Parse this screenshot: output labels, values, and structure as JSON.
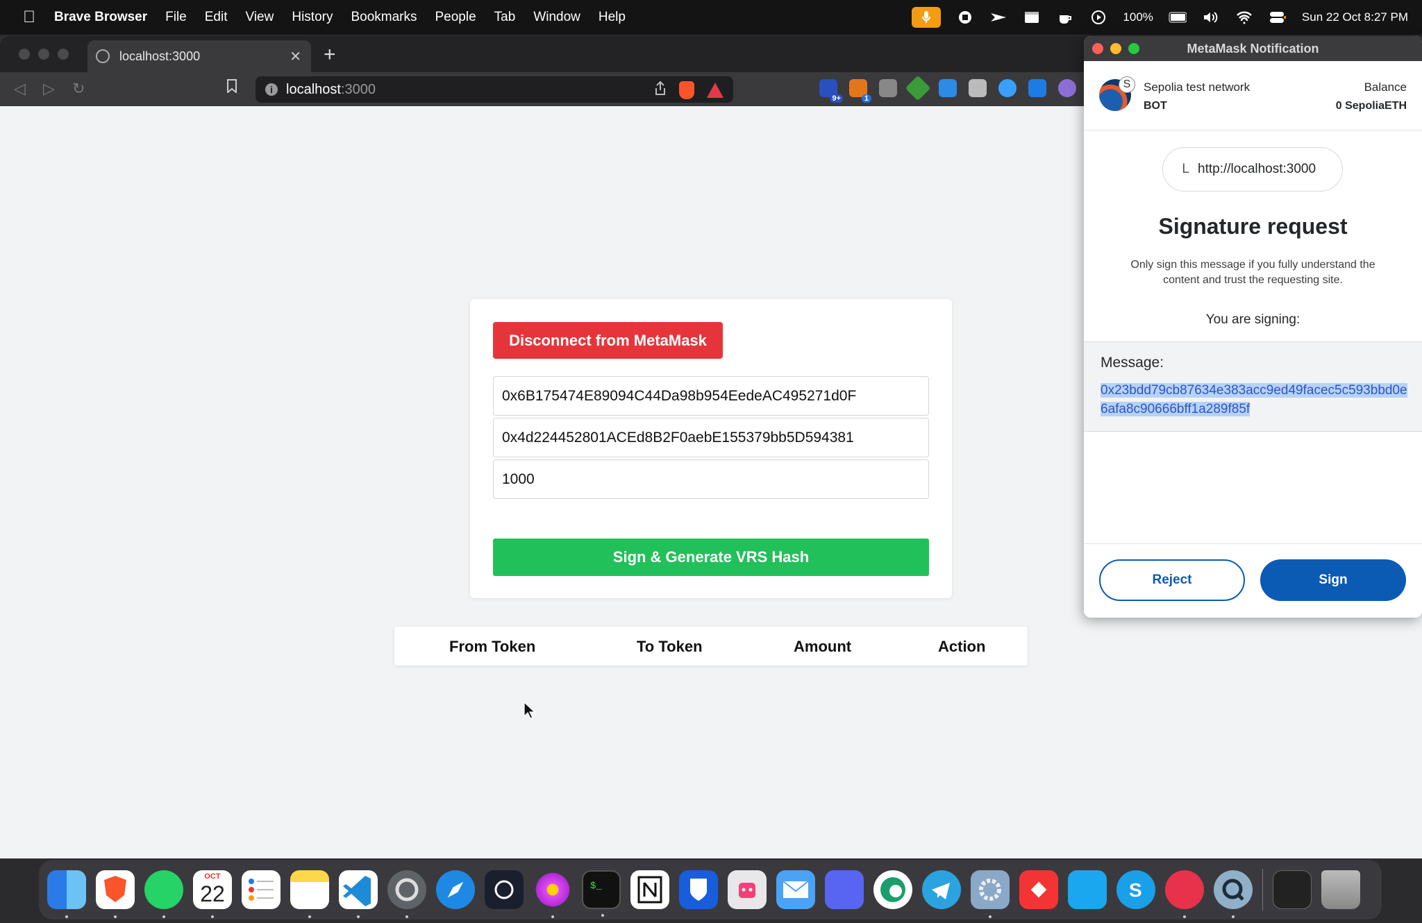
{
  "menubar": {
    "app_name": "Brave Browser",
    "items": [
      "File",
      "Edit",
      "View",
      "History",
      "Bookmarks",
      "People",
      "Tab",
      "Window",
      "Help"
    ],
    "battery": "100%",
    "datetime": "Sun 22 Oct  8:27 PM"
  },
  "browser": {
    "tab_title": "localhost:3000",
    "url_host": "localhost",
    "url_port": ":3000",
    "extension_badges": [
      "9+",
      "1"
    ]
  },
  "dapp": {
    "disconnect_label": "Disconnect from MetaMask",
    "from_token_value": "0x6B175474E89094C44Da98b954EedeAC495271d0F",
    "to_token_value": "0x4d224452801ACEd8B2F0aebE155379bb5D594381",
    "amount_value": "1000",
    "sign_label": "Sign & Generate VRS Hash",
    "table_headers": [
      "From Token",
      "To Token",
      "Amount",
      "Action"
    ]
  },
  "metamask": {
    "window_title": "MetaMask Notification",
    "network_badge": "S",
    "network_name": "Sepolia test network",
    "account_name": "BOT",
    "balance_label": "Balance",
    "balance_value": "0 SepoliaETH",
    "origin_initial": "L",
    "origin": "http://localhost:3000",
    "title": "Signature request",
    "warning": "Only sign this message if you fully understand the content and trust the requesting site.",
    "signing_label": "You are signing:",
    "message_label": "Message:",
    "message_value": "0x23bdd79cb87634e383acc9ed49facec5c593bbd0e6afa8c90666bff1a289f85f",
    "reject_label": "Reject",
    "sign_label": "Sign"
  },
  "dock": {
    "calendar_month": "OCT",
    "calendar_day": "22"
  },
  "colors": {
    "disconnect": "#e6353a",
    "sign_green": "#22c05a",
    "metamask_blue": "#0b5bb5"
  }
}
